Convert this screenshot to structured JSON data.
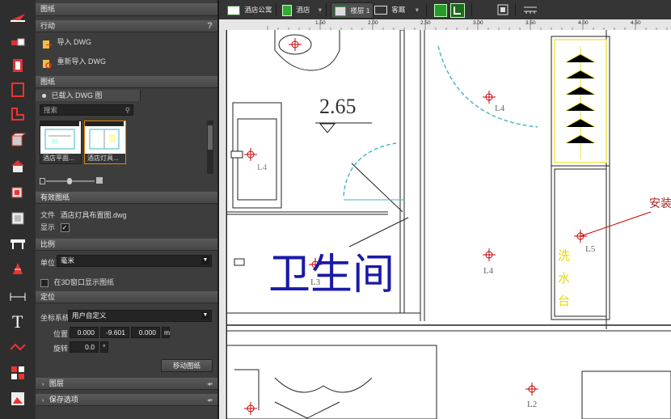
{
  "panel": {
    "title": "图纸",
    "actions_header": "行动",
    "help_glyph": "?",
    "import_dwg": "导入 DWG",
    "reimport_dwg": "重新导入 DWG",
    "drawings_header": "图纸",
    "loaded_tab": "已载入 DWG 图",
    "search_placeholder": "搜索",
    "thumbnails": [
      {
        "caption": "酒店平面..."
      },
      {
        "caption": "酒店灯具..."
      }
    ],
    "active_header": "有效图纸",
    "file_label": "文件",
    "file_name": "酒店灯具布置图.dwg",
    "show_label": "显示",
    "show_check": "✓",
    "scale_header": "比例",
    "unit_label": "单位",
    "unit_value": "毫米",
    "show3d_label": "在3D窗口显示图纸",
    "position_header": "定位",
    "coord_label": "坐标系统",
    "coord_value": "用户自定义",
    "pos_label": "位置",
    "pos_x": "0.000",
    "pos_y": "-9.601",
    "pos_z": "0.000",
    "pos_unit": "m",
    "rot_label": "旋转",
    "rot_value": "0.0",
    "rot_unit": "°",
    "move_button": "移动图纸",
    "layers_header": "图层",
    "save_header": "保存选项"
  },
  "toolbar": {
    "item1": "酒店公寓",
    "item2": "酒店",
    "item3": "楼层 1",
    "item4": "客厩"
  },
  "ruler": {
    "labels": [
      "1.50",
      "2.00",
      "2.50",
      "3.00",
      "3.50",
      "4.00",
      "4.50"
    ]
  },
  "canvas": {
    "level_text": "2.65",
    "room_text": "卫生间",
    "install_text": "安装",
    "vertical_text": "洗水台",
    "light_labels": [
      "L4",
      "L4",
      "L4",
      "L5",
      "L3",
      "L2"
    ]
  },
  "colors": {
    "panel_bg": "#3d3d3d",
    "cad_blue": "#1a1aa8",
    "cad_red": "#cc0000",
    "cad_yellow": "#e8d800",
    "cad_cyan": "#3fb6c6"
  }
}
